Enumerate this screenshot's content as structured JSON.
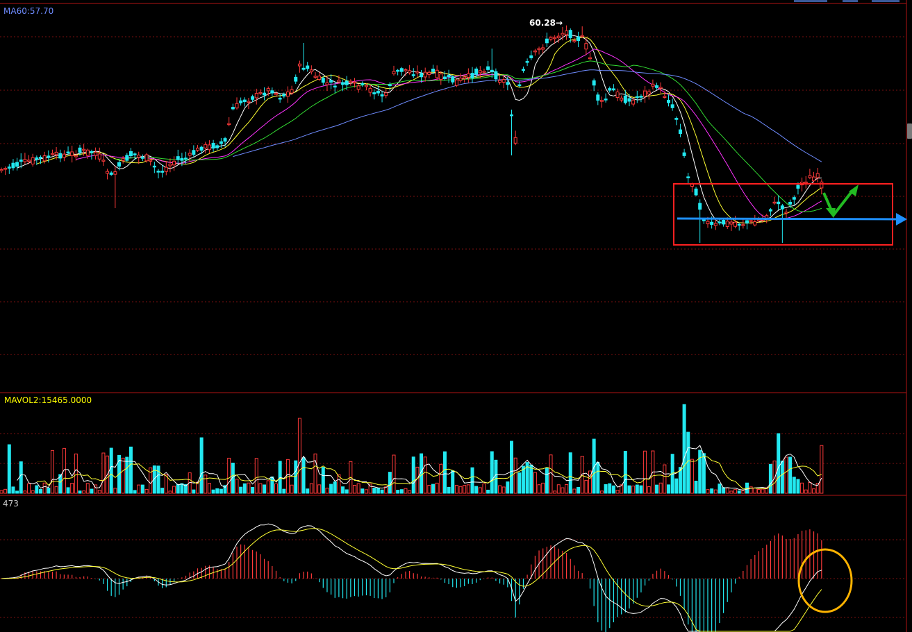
{
  "panels": {
    "price": {
      "label": "MA60:57.70",
      "label_color": "#6f8cff",
      "peak_label": "60.28→"
    },
    "volume": {
      "label": "MAVOL2:15465.0000",
      "label_color": "#ffff00"
    },
    "macd": {
      "label": "473",
      "label_color": "#c8c8c8"
    }
  },
  "colors": {
    "background": "#000000",
    "grid": "#7a1010",
    "axis": "#b01515",
    "up": "#ff3a3a",
    "down": "#22e8f0",
    "ma5": "#ffffff",
    "ma10": "#ffff33",
    "ma20": "#ff33ff",
    "ma30": "#33dd33",
    "ma60": "#6f8cff",
    "annotation_box": "#ff2020",
    "support_arrow": "#1e90ff",
    "trend_arrow": "#22bb22",
    "circle": "#ffb300"
  },
  "chart_data": {
    "type": "candlestick",
    "indicators": [
      "MA5",
      "MA10",
      "MA20",
      "MA30",
      "MA60",
      "VOL",
      "MAVOL1",
      "MAVOL2",
      "MACD"
    ],
    "visible_values": {
      "MA60": 57.7,
      "MAVOL2": 15465.0,
      "high": 60.28
    },
    "annotations": [
      "consolidation-box",
      "support-line-arrow",
      "green-v-arrow",
      "macd-circle"
    ]
  }
}
